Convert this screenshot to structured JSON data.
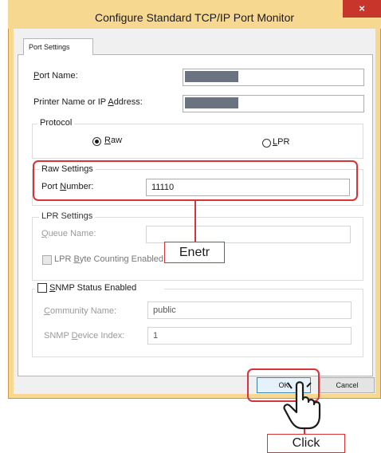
{
  "window": {
    "title": "Configure Standard TCP/IP Port Monitor",
    "close_symbol": "×"
  },
  "tabs": [
    {
      "label": "Port Settings"
    }
  ],
  "port_name": {
    "label": "Port Name:",
    "accelerator": "P",
    "value_redacted": true
  },
  "printer_name": {
    "label": "Printer Name or IP Address:",
    "accelerator": "A",
    "value_redacted": true
  },
  "protocol": {
    "legend": "Protocol",
    "options": [
      {
        "label": "Raw",
        "selected": true
      },
      {
        "label": "LPR",
        "selected": false
      }
    ]
  },
  "raw_settings": {
    "legend": "Raw Settings",
    "port_number_label": "Port Number:",
    "port_number_value": "11110"
  },
  "lpr_settings": {
    "legend": "LPR Settings",
    "queue_name_label": "Queue Name:",
    "queue_name_value": "",
    "byte_counting_label": "LPR Byte Counting Enabled"
  },
  "snmp": {
    "label": "SNMP Status Enabled",
    "community_label": "Community Name:",
    "community_value": "public",
    "device_index_label": "SNMP Device Index:",
    "device_index_value": "1"
  },
  "buttons": {
    "ok": "OK",
    "cancel": "Cancel"
  },
  "annotations": {
    "enter": "Enetr",
    "click": "Click"
  },
  "colors": {
    "highlight_red": "#d8333a",
    "title_bar": "#f7d890",
    "close_button": "#c8352a"
  }
}
